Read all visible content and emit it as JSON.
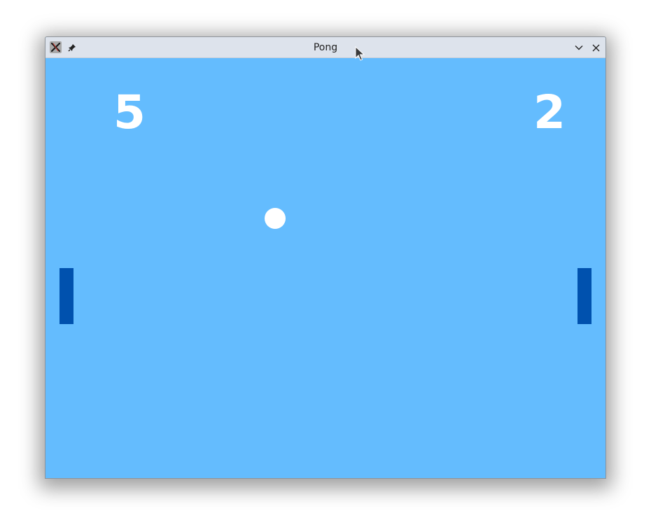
{
  "window": {
    "title": "Pong"
  },
  "titlebar_icons": {
    "app": "app-icon",
    "pin": "pin-icon",
    "minimize": "chevron-down-icon",
    "close": "close-icon"
  },
  "game": {
    "score_left": "5",
    "score_right": "2"
  },
  "colors": {
    "background": "#64bcfe",
    "paddle": "#0051ae",
    "ball": "#ffffff",
    "score": "#ffffff",
    "titlebar": "#dde3ec"
  }
}
